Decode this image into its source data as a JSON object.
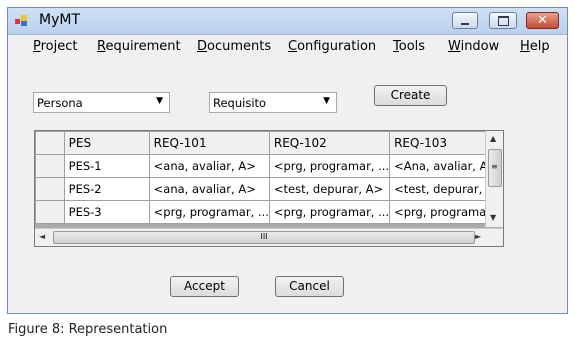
{
  "window": {
    "title": "MyMT"
  },
  "titlebar_buttons": {
    "close_glyph": "✕"
  },
  "menu": [
    {
      "label": "Project",
      "mnemonic": "P",
      "rest": "roject"
    },
    {
      "label": "Requirement",
      "mnemonic": "R",
      "rest": "equirement"
    },
    {
      "label": "Documents",
      "mnemonic": "D",
      "rest": "ocuments"
    },
    {
      "label": "Configuration",
      "mnemonic": "C",
      "rest": "onfiguration"
    },
    {
      "label": "Tools",
      "mnemonic": "T",
      "rest": "ools"
    },
    {
      "label": "Window",
      "mnemonic": "W",
      "rest": "indow"
    },
    {
      "label": "Help",
      "mnemonic": "H",
      "rest": "elp"
    }
  ],
  "controls": {
    "select1": {
      "value": "Persona",
      "arrow": "▼"
    },
    "select2": {
      "value": "Requisito",
      "arrow": "▼"
    },
    "create_label": "Create",
    "accept_label": "Accept",
    "cancel_label": "Cancel"
  },
  "grid": {
    "columns": [
      "PES",
      "REQ-101",
      "REQ-102",
      "REQ-103"
    ],
    "rows": [
      [
        "PES-1",
        "<ana, avaliar, A>",
        "<prg, programar, ...",
        "<Ana, avaliar, A>"
      ],
      [
        "PES-2",
        "<ana, avaliar, A>",
        "<test, depurar, A>",
        "<test, depurar, A"
      ],
      [
        "PES-3",
        "<prg, programar, ...",
        "<prg, programar, ...",
        "<prg, programar, ."
      ]
    ],
    "scroll": {
      "up": "▲",
      "down": "▼",
      "left": "◄",
      "right": "►",
      "grip_h": "III",
      "grip_v": "≡"
    }
  },
  "caption": "Figure 8: Representation"
}
